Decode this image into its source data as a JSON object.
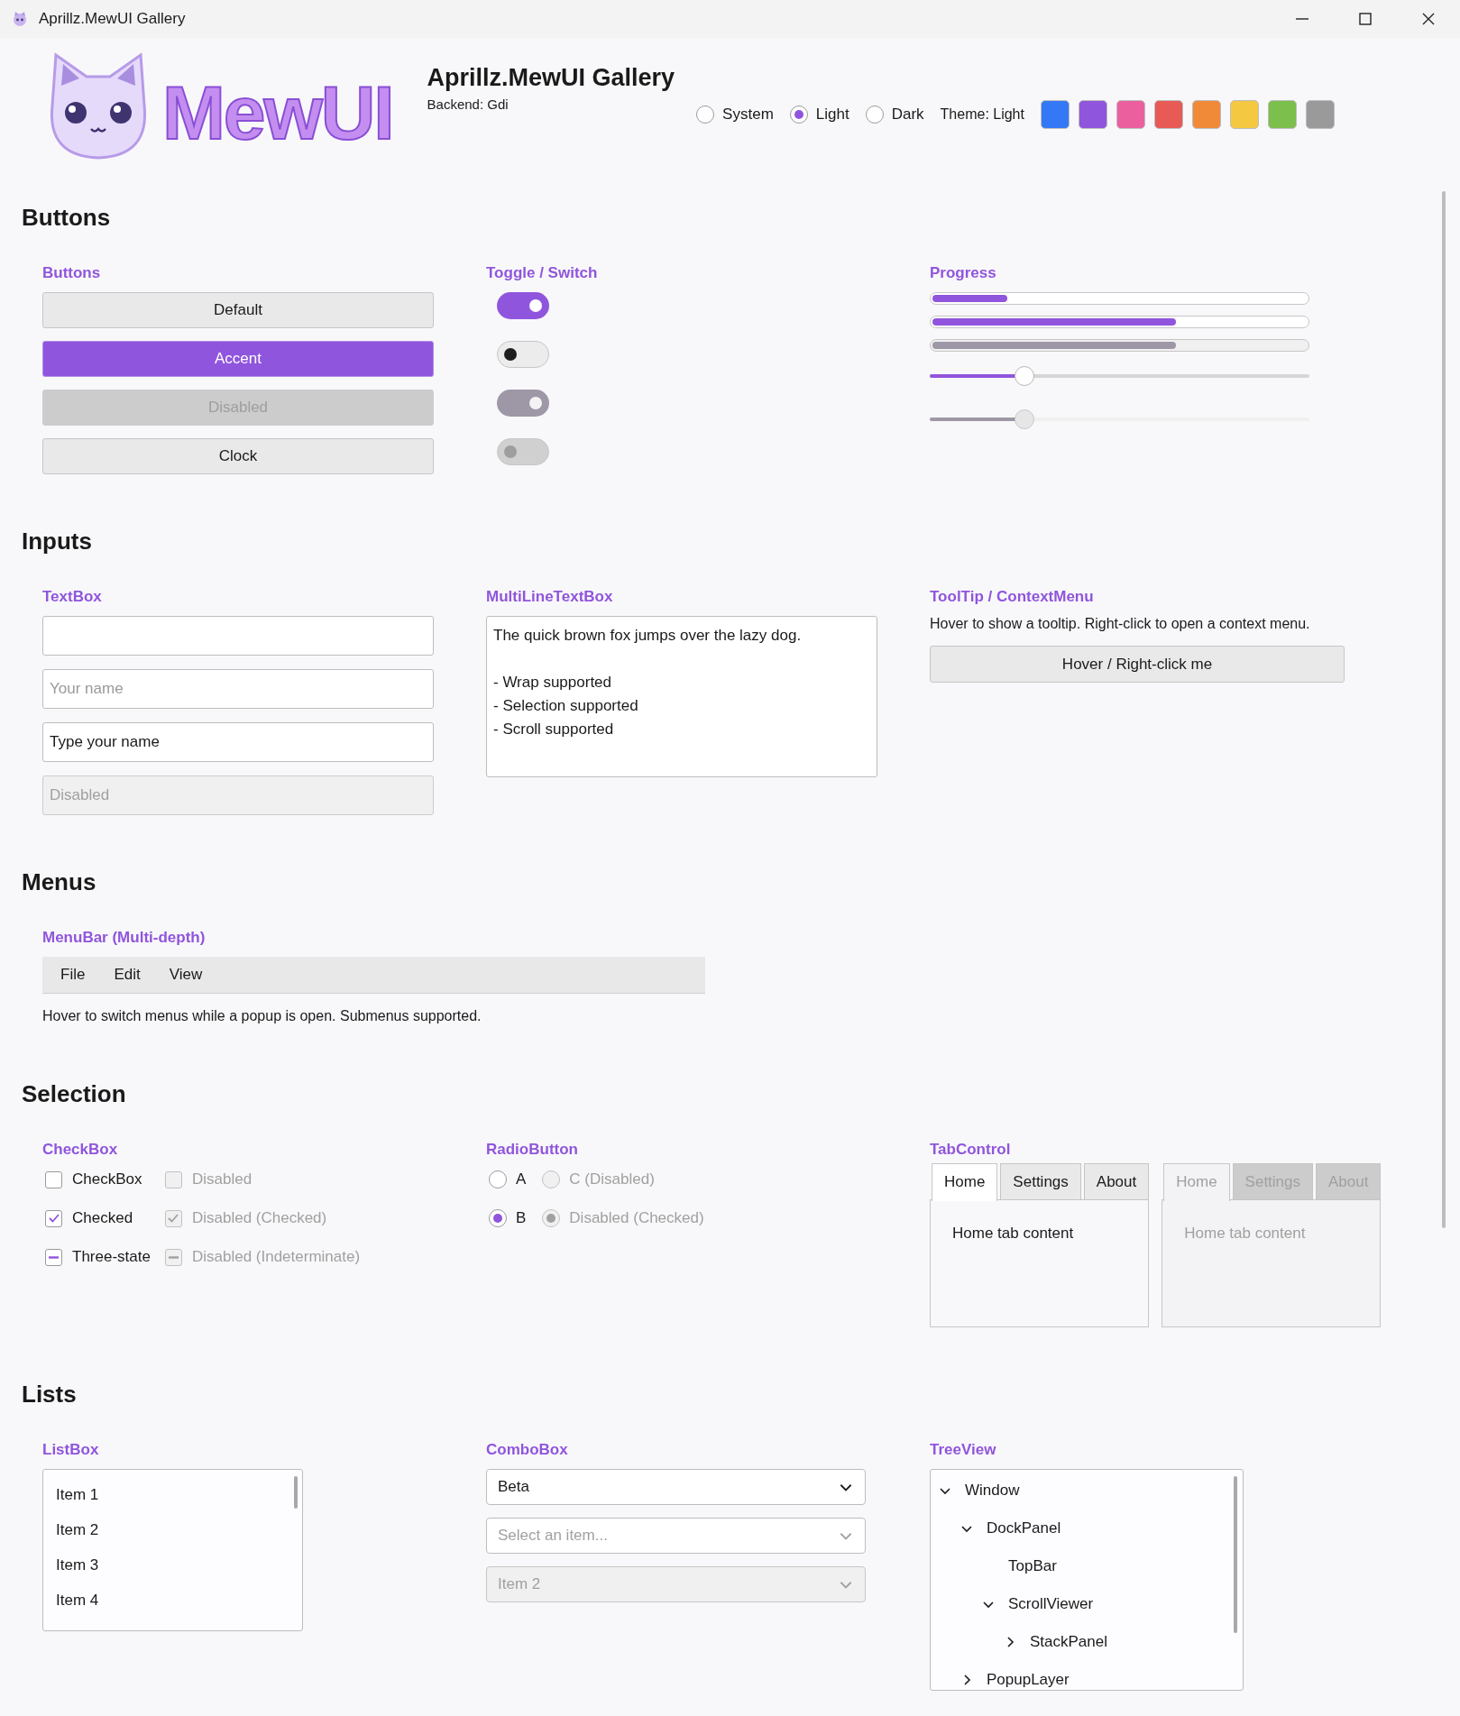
{
  "window": {
    "title": "Aprillz.MewUI Gallery"
  },
  "header": {
    "logo_text": "MewUI",
    "title": "Aprillz.MewUI Gallery",
    "backend": "Backend: Gdi",
    "theme_options": [
      {
        "label": "System",
        "selected": false
      },
      {
        "label": "Light",
        "selected": true
      },
      {
        "label": "Dark",
        "selected": false
      }
    ],
    "theme_label": "Theme: Light",
    "accent_swatches": [
      {
        "color": "#3478f6"
      },
      {
        "color": "#9055dd"
      },
      {
        "color": "#ec5f9f"
      },
      {
        "color": "#e85a55"
      },
      {
        "color": "#f08a38"
      },
      {
        "color": "#f5c842"
      },
      {
        "color": "#7cbf4c"
      },
      {
        "color": "#9a9a9a"
      }
    ]
  },
  "sections": [
    {
      "title": "Buttons",
      "groups": [
        {
          "kind": "buttons",
          "title": "Buttons",
          "items": [
            {
              "label": "Default",
              "kind": "default"
            },
            {
              "label": "Accent",
              "kind": "accent"
            },
            {
              "label": "Disabled",
              "kind": "disabled"
            },
            {
              "label": "Clock",
              "kind": "default"
            }
          ]
        },
        {
          "kind": "toggles",
          "title": "Toggle / Switch",
          "items": [
            {
              "on": true,
              "disabled": false
            },
            {
              "on": false,
              "disabled": false
            },
            {
              "on": true,
              "disabled": true
            },
            {
              "on": false,
              "disabled": true
            }
          ]
        },
        {
          "kind": "progress",
          "title": "Progress",
          "bars": [
            {
              "level": 0.2,
              "disabled": false
            },
            {
              "level": 0.65,
              "disabled": false
            },
            {
              "level": 0.65,
              "disabled": true
            }
          ],
          "sliders": [
            {
              "level": 0.25,
              "disabled": false
            },
            {
              "level": 0.25,
              "disabled": true
            }
          ]
        }
      ]
    },
    {
      "title": "Inputs",
      "groups": [
        {
          "kind": "textboxes",
          "title": "TextBox",
          "items": [
            {
              "disabled": false
            },
            {
              "placeholder": "Your name",
              "disabled": false
            },
            {
              "value": "Type your name",
              "disabled": false
            },
            {
              "value": "Disabled",
              "disabled": true
            }
          ]
        },
        {
          "kind": "multiline",
          "title": "MultiLineTextBox",
          "value": "The quick brown fox jumps over the lazy dog.\n\n- Wrap supported\n- Selection supported\n- Scroll supported"
        },
        {
          "kind": "tooltip",
          "title": "ToolTip / ContextMenu",
          "description": "Hover to show a tooltip. Right-click to open a context menu.",
          "button": "Hover / Right-click me"
        }
      ]
    },
    {
      "title": "Menus",
      "groups": [
        {
          "kind": "menubar",
          "title": "MenuBar (Multi-depth)",
          "items": [
            "File",
            "Edit",
            "View"
          ],
          "note": "Hover to switch menus while a popup is open. Submenus supported."
        }
      ]
    },
    {
      "title": "Selection",
      "groups": [
        {
          "kind": "checkboxes",
          "title": "CheckBox",
          "items": [
            {
              "label": "CheckBox",
              "checked": false,
              "indeterminate": false,
              "disabled": false
            },
            {
              "label": "Disabled",
              "checked": false,
              "indeterminate": false,
              "disabled": true
            },
            {
              "label": "Checked",
              "checked": true,
              "indeterminate": false,
              "disabled": false
            },
            {
              "label": "Disabled (Checked)",
              "checked": true,
              "indeterminate": false,
              "disabled": true
            },
            {
              "label": "Three-state",
              "checked": false,
              "indeterminate": true,
              "disabled": false
            },
            {
              "label": "Disabled (Indeterminate)",
              "checked": false,
              "indeterminate": true,
              "disabled": true
            }
          ]
        },
        {
          "kind": "radios",
          "title": "RadioButton",
          "items": [
            {
              "label": "A",
              "selected": false,
              "disabled": false
            },
            {
              "label": "C (Disabled)",
              "selected": false,
              "disabled": true
            },
            {
              "label": "B",
              "selected": true,
              "disabled": false
            },
            {
              "label": "Disabled (Checked)",
              "selected": true,
              "disabled": true
            }
          ]
        },
        {
          "kind": "tabs",
          "title": "TabControl",
          "controls": [
            {
              "disabled": false,
              "tabs": [
                {
                  "label": "Home",
                  "selected": true
                },
                {
                  "label": "Settings",
                  "selected": false
                },
                {
                  "label": "About",
                  "selected": false
                }
              ],
              "content": "Home tab content"
            },
            {
              "disabled": true,
              "tabs": [
                {
                  "label": "Home",
                  "selected": true
                },
                {
                  "label": "Settings",
                  "selected": false
                },
                {
                  "label": "About",
                  "selected": false
                }
              ],
              "content": "Home tab content"
            }
          ]
        }
      ]
    },
    {
      "title": "Lists",
      "groups": [
        {
          "kind": "listbox",
          "title": "ListBox",
          "items": [
            "Item 1",
            "Item 2",
            "Item 3",
            "Item 4"
          ]
        },
        {
          "kind": "combos",
          "title": "ComboBox",
          "items": [
            {
              "value": "Beta",
              "disabled": false
            },
            {
              "placeholder": "Select an item...",
              "disabled": false
            },
            {
              "value": "Item 2",
              "disabled": true
            }
          ]
        },
        {
          "kind": "tree",
          "title": "TreeView",
          "nodes": [
            {
              "label": "Window",
              "expanded": true,
              "children": [
                {
                  "label": "DockPanel",
                  "expanded": true,
                  "children": [
                    {
                      "label": "TopBar"
                    },
                    {
                      "label": "ScrollViewer",
                      "expanded": true,
                      "children": [
                        {
                          "label": "StackPanel",
                          "expanded": false
                        }
                      ]
                    }
                  ]
                },
                {
                  "label": "PopupLayer",
                  "expanded": false
                }
              ]
            }
          ]
        }
      ]
    }
  ]
}
